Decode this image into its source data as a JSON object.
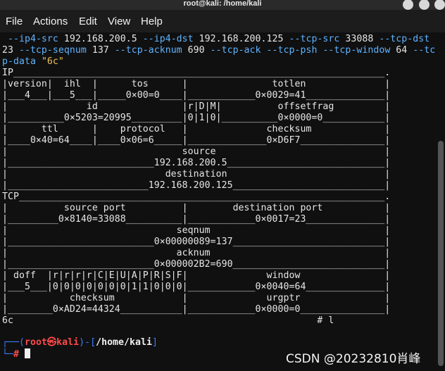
{
  "window": {
    "title": "root@kali: /home/kali"
  },
  "menu": {
    "items": [
      "File",
      "Actions",
      "Edit",
      "View",
      "Help"
    ]
  },
  "command": {
    "line1_parts": [
      {
        "t": " ",
        "k": "c"
      },
      {
        "t": "--ip4-src",
        "k": "opt"
      },
      {
        "t": " 192.168.200.5 ",
        "k": "c"
      },
      {
        "t": "--ip4-dst",
        "k": "opt"
      },
      {
        "t": " 192.168.200.125 ",
        "k": "c"
      },
      {
        "t": "--tcp-src",
        "k": "opt"
      },
      {
        "t": " 33088 ",
        "k": "c"
      },
      {
        "t": "--tcp-dst",
        "k": "opt"
      }
    ],
    "line2_parts": [
      {
        "t": "23 ",
        "k": "c"
      },
      {
        "t": "--tcp-seqnum",
        "k": "opt"
      },
      {
        "t": " 137 ",
        "k": "c"
      },
      {
        "t": "--tcp-acknum",
        "k": "opt"
      },
      {
        "t": " 690 ",
        "k": "c"
      },
      {
        "t": "--tcp-ack",
        "k": "opt"
      },
      {
        "t": " ",
        "k": "c"
      },
      {
        "t": "--tcp-psh",
        "k": "opt"
      },
      {
        "t": " ",
        "k": "c"
      },
      {
        "t": "--tcp-window",
        "k": "opt"
      },
      {
        "t": " 64 ",
        "k": "c"
      },
      {
        "t": "--tc",
        "k": "opt"
      }
    ],
    "line3_parts": [
      {
        "t": "p-data",
        "k": "opt"
      },
      {
        "t": " ",
        "k": "c"
      },
      {
        "t": "\"6c\"",
        "k": "str"
      }
    ]
  },
  "output_lines": [
    "IP__________________________________________________________________.",
    "|version|  ihl  |      tos      |               totlen              |",
    "|___4___|___5___|_____0×00=0____|____________0×0029=41______________|",
    "|              id               |r|D|M|          offsetfrag         |",
    "|__________0×5203=20995_________|0|1|0|__________0×0000=0___________|",
    "|      ttl      |    protocol   |              checksum             |",
    "|____0×40=64____|____0×06=6_____|______________0×D6F7_______________|",
    "|                               source                              |",
    "|__________________________192.168.200.5____________________________|",
    "|                            destination                            |",
    "|_________________________192.168.200.125___________________________|",
    "TCP_________________________________________________________________.",
    "|          source port          |        destination port           |",
    "|_________0×8140=33088__________|____________0×0017=23______________|",
    "|                              seqnum                               |",
    "|__________________________0×00000089=137___________________________|",
    "|                              acknum                               |",
    "|__________________________0×000002B2=690___________________________|",
    "| doff  |r|r|r|r|C|E|U|A|P|R|S|F|              window               |",
    "|___5___|0|0|0|0|0|0|0|1|1|0|0|0|____________0×0040=64______________|",
    "|           checksum            |              urgptr               |",
    "|________0×AD24=44324___________|____________0×0000=0_______________|",
    "6c                                                      # l"
  ],
  "prompt": {
    "corner_top": "┌──(",
    "user": "root㉿kali",
    "close_paren": ")-[",
    "path": "/home/kali",
    "close_bracket": "]",
    "corner_bottom": "└─",
    "symbol": "#"
  },
  "watermark": "CSDN @20232810肖峰"
}
